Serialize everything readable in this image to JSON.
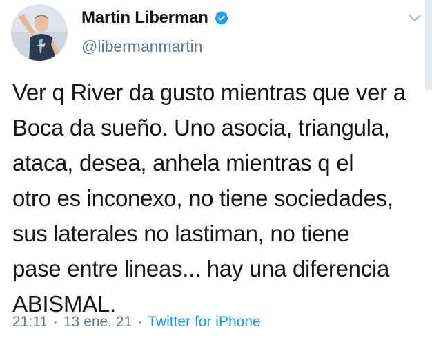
{
  "author": {
    "name": "Martin Liberman",
    "handle": "@libermanmartin",
    "verified": true,
    "avatar_icon": "profile-photo"
  },
  "tweet": {
    "lines": [
      "Ver q River da gusto mientras que ver a",
      "Boca da sueño. Uno asocia, triangula,",
      "ataca, desea, anhela mientras q el",
      "otro es inconexo, no tiene sociedades,",
      "sus laterales no lastiman, no tiene",
      "pase entre lineas... hay una diferencia",
      "ABISMAL."
    ]
  },
  "meta": {
    "time": "21:11",
    "separator_1": "·",
    "date": "13 ene. 21",
    "separator_2": "·",
    "source": "Twitter for iPhone"
  },
  "colors": {
    "text": "#14171a",
    "secondary": "#657786",
    "link": "#1b95e0",
    "verified": "#1da1f2"
  }
}
